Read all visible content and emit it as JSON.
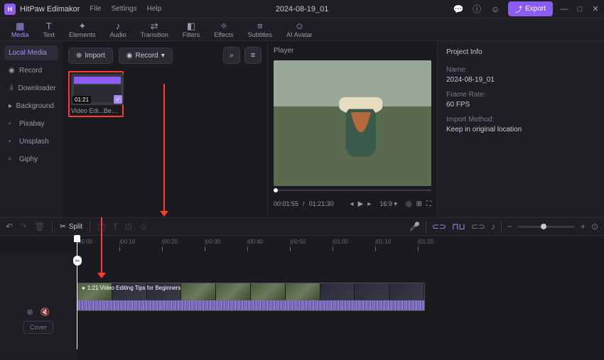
{
  "titlebar": {
    "app_name": "HitPaw Edimakor",
    "menus": [
      "File",
      "Settings",
      "Help"
    ],
    "project_title": "2024-08-19_01",
    "export_label": "Export"
  },
  "tooltabs": {
    "items": [
      {
        "label": "Media",
        "icon": "▦"
      },
      {
        "label": "Text",
        "icon": "T"
      },
      {
        "label": "Elements",
        "icon": "✦"
      },
      {
        "label": "Audio",
        "icon": "♪"
      },
      {
        "label": "Transition",
        "icon": "⇄"
      },
      {
        "label": "Filters",
        "icon": "◧"
      },
      {
        "label": "Effects",
        "icon": "✧"
      },
      {
        "label": "Subtitles",
        "icon": "≡"
      },
      {
        "label": "AI Avatar",
        "icon": "☺"
      }
    ]
  },
  "sidebar": {
    "items": [
      {
        "label": "Local Media",
        "icon": "▢"
      },
      {
        "label": "Record",
        "icon": "◉"
      },
      {
        "label": "Downloader",
        "icon": "⇩"
      },
      {
        "label": "Background",
        "icon": "▸"
      },
      {
        "label": "Pixabay",
        "icon": "▫"
      },
      {
        "label": "Unsplash",
        "icon": "▫"
      },
      {
        "label": "Giphy",
        "icon": "▫"
      }
    ]
  },
  "mediapanel": {
    "import_label": "Import",
    "record_label": "Record",
    "thumb": {
      "duration": "01:21",
      "caption": "Video Edi...Beginners"
    }
  },
  "player": {
    "title": "Player",
    "current_time": "00:01:55",
    "total_time": "01:21:30",
    "aspect": "16:9"
  },
  "info": {
    "title": "Project Info",
    "name_label": "Name:",
    "name_value": "2024-08-19_01",
    "framerate_label": "Frame Rate:",
    "framerate_value": "60 FPS",
    "import_label": "Import Method:",
    "import_value": "Keep in original location"
  },
  "timebar": {
    "split_label": "Split"
  },
  "ruler": {
    "marks": [
      "|00:00",
      "|00:10",
      "|00:20",
      "|00:30",
      "|00:40",
      "|00:50",
      "|01:00",
      "|01:10",
      "|01:20"
    ]
  },
  "tracks": {
    "cover_label": "Cover",
    "clip_label": "1:21 Video Editing Tips for Beginners"
  }
}
